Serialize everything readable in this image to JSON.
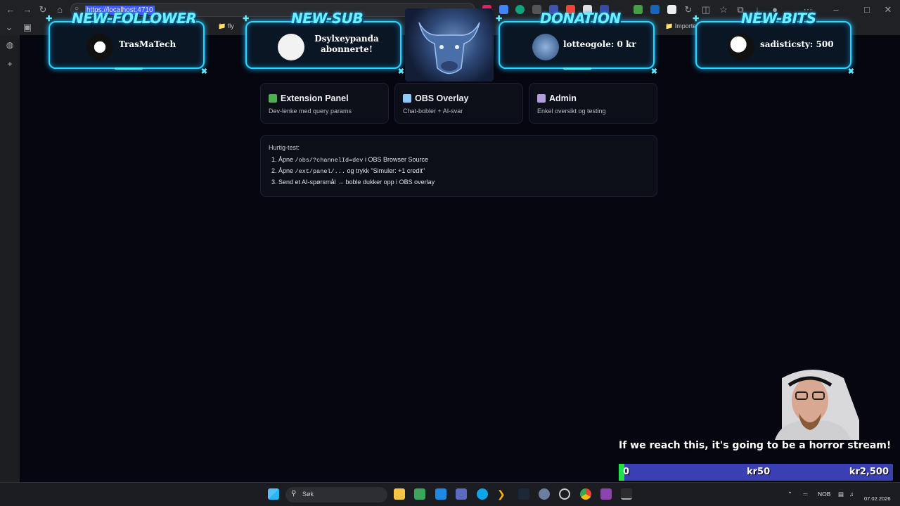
{
  "browser": {
    "url": "https://localhost:4710",
    "bookmarks": [
      "fly",
      "Importe"
    ]
  },
  "alerts": [
    {
      "heading": "NEW-FOLLOWER",
      "text": "TrasMaTech"
    },
    {
      "heading": "NEW-SUB",
      "text": "Dsylxeypanda abonnerte!"
    },
    {
      "heading": "DONATION",
      "text": "lotteogole: 0 kr"
    },
    {
      "heading": "NEW-BITS",
      "text": "sadisticsty: 500"
    }
  ],
  "cards": [
    {
      "title": "Extension Panel",
      "subtitle": "Dev-lenke med query params",
      "icon": "puzzle-icon",
      "color": "#4caf50"
    },
    {
      "title": "OBS Overlay",
      "subtitle": "Chat-bobler + AI-svar",
      "icon": "overlay-icon",
      "color": "#90caf9"
    },
    {
      "title": "Admin",
      "subtitle": "Enkel oversikt og testing",
      "icon": "grid-icon",
      "color": "#b39ddb"
    }
  ],
  "quick_test": {
    "title": "Hurtig-test:",
    "steps": [
      {
        "pre": "Åpne ",
        "code": "/obs/?channelId=dev",
        "post": " i OBS Browser Source"
      },
      {
        "pre": "Åpne ",
        "code": "/ext/panel/...",
        "post": " og trykk \"Simuler: +1 credit\""
      },
      {
        "pre": "Send et AI-spørsmål → boble dukker opp i OBS overlay",
        "code": "",
        "post": ""
      }
    ]
  },
  "goal": {
    "text": "If we reach this, it's going to be a horror stream!",
    "start_label": "0",
    "current_label": "kr50",
    "target_label": "kr2,500",
    "progress": 0.02,
    "fill_color": "#22e04a",
    "bar_color": "#3b3fb4"
  },
  "taskbar": {
    "search_label": "Søk",
    "language": "NOB",
    "date": "07.02.2026"
  }
}
